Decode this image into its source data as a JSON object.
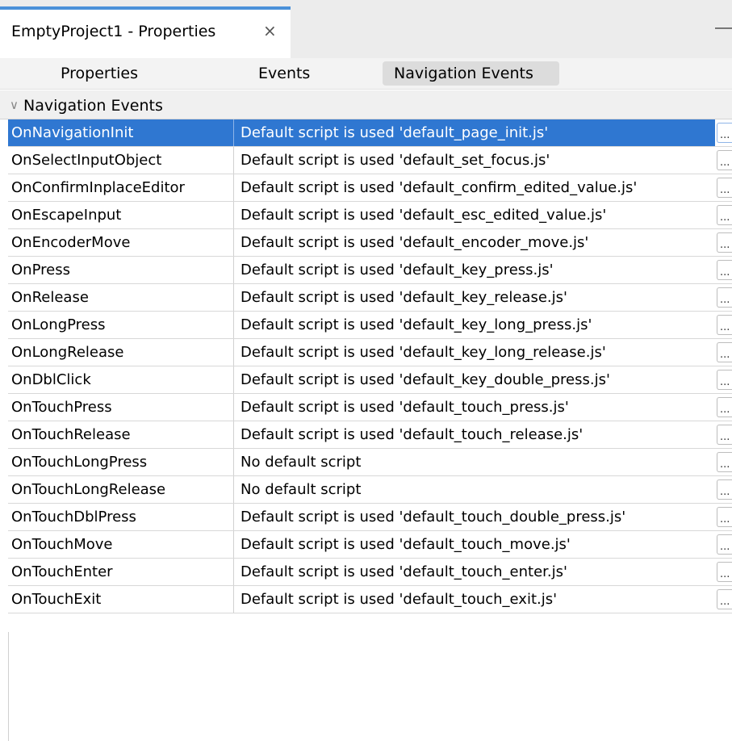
{
  "window": {
    "tab_title": "EmptyProject1 - Properties",
    "close_glyph": "×"
  },
  "subtabs": [
    {
      "label": "Properties",
      "active": false
    },
    {
      "label": "Events",
      "active": false
    },
    {
      "label": "Navigation Events",
      "active": true
    }
  ],
  "group": {
    "title": "Navigation Events",
    "chevron": "∨"
  },
  "ellipsis_label": "...",
  "rows": [
    {
      "name": "OnNavigationInit",
      "value": "Default script is used 'default_page_init.js'",
      "selected": true
    },
    {
      "name": "OnSelectInputObject",
      "value": "Default script is used 'default_set_focus.js'"
    },
    {
      "name": "OnConfirmInplaceEditor",
      "value": "Default script is used 'default_confirm_edited_value.js'"
    },
    {
      "name": "OnEscapeInput",
      "value": "Default script is used 'default_esc_edited_value.js'"
    },
    {
      "name": "OnEncoderMove",
      "value": "Default script is used 'default_encoder_move.js'"
    },
    {
      "name": "OnPress",
      "value": "Default script is used 'default_key_press.js'"
    },
    {
      "name": "OnRelease",
      "value": "Default script is used 'default_key_release.js'"
    },
    {
      "name": "OnLongPress",
      "value": "Default script is used 'default_key_long_press.js'"
    },
    {
      "name": "OnLongRelease",
      "value": "Default script is used 'default_key_long_release.js'"
    },
    {
      "name": "OnDblClick",
      "value": "Default script is used 'default_key_double_press.js'"
    },
    {
      "name": "OnTouchPress",
      "value": "Default script is used 'default_touch_press.js'"
    },
    {
      "name": "OnTouchRelease",
      "value": "Default script is used 'default_touch_release.js'"
    },
    {
      "name": "OnTouchLongPress",
      "value": "No default script"
    },
    {
      "name": "OnTouchLongRelease",
      "value": "No default script"
    },
    {
      "name": "OnTouchDblPress",
      "value": "Default script is used 'default_touch_double_press.js'"
    },
    {
      "name": "OnTouchMove",
      "value": "Default script is used 'default_touch_move.js'"
    },
    {
      "name": "OnTouchEnter",
      "value": "Default script is used 'default_touch_enter.js'"
    },
    {
      "name": "OnTouchExit",
      "value": "Default script is used 'default_touch_exit.js'"
    }
  ],
  "colors": {
    "selection": "#2f77d1",
    "tab_accent": "#4a90d9"
  }
}
